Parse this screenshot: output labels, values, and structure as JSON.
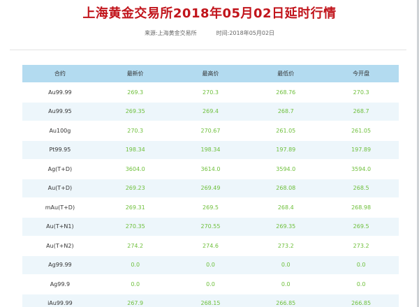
{
  "page": {
    "title": "上海黄金交易所2018年05月02日延时行情",
    "source_label": "来源:上海黄金交易所",
    "time_label": "时间:2018年05月02日"
  },
  "table": {
    "headers": [
      "合约",
      "最新价",
      "最高价",
      "最低价",
      "今开盘"
    ],
    "rows": [
      [
        "Au99.99",
        "269.3",
        "270.3",
        "268.76",
        "270.3"
      ],
      [
        "Au99.95",
        "269.35",
        "269.4",
        "268.7",
        "268.7"
      ],
      [
        "Au100g",
        "270.3",
        "270.67",
        "261.05",
        "261.05"
      ],
      [
        "Pt99.95",
        "198.34",
        "198.34",
        "197.89",
        "197.89"
      ],
      [
        "Ag(T+D)",
        "3604.0",
        "3614.0",
        "3594.0",
        "3594.0"
      ],
      [
        "Au(T+D)",
        "269.23",
        "269.49",
        "268.08",
        "268.5"
      ],
      [
        "mAu(T+D)",
        "269.31",
        "269.5",
        "268.4",
        "268.98"
      ],
      [
        "Au(T+N1)",
        "270.35",
        "270.55",
        "269.35",
        "269.5"
      ],
      [
        "Au(T+N2)",
        "274.2",
        "274.6",
        "273.2",
        "273.2"
      ],
      [
        "Ag99.99",
        "0.0",
        "0.0",
        "0.0",
        "0.0"
      ],
      [
        "Ag99.9",
        "0.0",
        "0.0",
        "0.0",
        "0.0"
      ],
      [
        "iAu99.99",
        "267.9",
        "268.15",
        "266.85",
        "266.85"
      ]
    ]
  },
  "colors": {
    "title": "#c1141b",
    "header_bg": "#b3dbf0",
    "price_text": "#6dbf3a",
    "alt_row_bg": "#edf6fb"
  }
}
